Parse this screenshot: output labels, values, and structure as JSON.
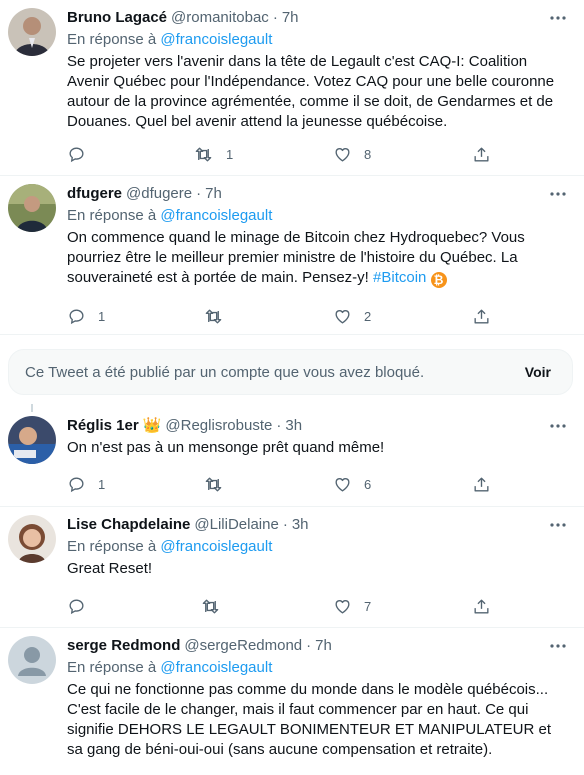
{
  "tweets": [
    {
      "name": "Bruno Lagacé",
      "handle": "@romanitobac",
      "time": "7h",
      "reply_prefix": "En réponse à ",
      "reply_to": "@francoislegault",
      "text": "Se projeter vers l'avenir dans la tête de Legault c'est CAQ-I: Coalition Avenir Québec pour l'Indépendance. Votez CAQ pour une belle couronne autour de la province agrémentée, comme il se doit, de Gendarmes et de Douanes. Quel bel avenir attend la jeunesse québécoise.",
      "replies": "",
      "retweets": "1",
      "likes": "8"
    },
    {
      "name": "dfugere",
      "handle": "@dfugere",
      "time": "7h",
      "reply_prefix": "En réponse à ",
      "reply_to": "@francoislegault",
      "text": "On commence quand le minage de Bitcoin chez Hydroquebec? Vous pourriez être le meilleur premier ministre de l'histoire du Québec. La souveraineté est à portée de main. Pensez-y!",
      "hashtag": "#Bitcoin",
      "emoji": "₿",
      "replies": "1",
      "retweets": "",
      "likes": "2"
    },
    {
      "name": "Réglis 1er",
      "emoji": "👑",
      "handle": "@Reglisrobuste",
      "time": "3h",
      "text": "On n'est pas à un mensonge prêt quand même!",
      "replies": "1",
      "retweets": "",
      "likes": "6"
    },
    {
      "name": "Lise Chapdelaine",
      "handle": "@LiliDelaine",
      "time": "3h",
      "reply_prefix": "En réponse à ",
      "reply_to": "@francoislegault",
      "text": "Great Reset!",
      "replies": "",
      "retweets": "",
      "likes": "7"
    },
    {
      "name": "serge Redmond",
      "handle": "@sergeRedmond",
      "time": "7h",
      "reply_prefix": "En réponse à ",
      "reply_to": "@francoislegault",
      "text": "Ce qui ne fonctionne pas comme du monde dans le modèle québécois... C'est facile de le changer, mais il faut commencer par en haut. Ce qui signifie DEHORS LE LEGAULT BONIMENTEUR ET MANIPULATEUR et sa gang de béni-oui-oui (sans aucune compensation et retraite)."
    }
  ],
  "blocked_notice": {
    "text": "Ce Tweet a été publié par un compte que vous avez bloqué.",
    "button": "Voir"
  },
  "dot": "·",
  "colors": {
    "accent": "#1d9bf0",
    "muted": "#536471",
    "text": "#0f1419"
  }
}
